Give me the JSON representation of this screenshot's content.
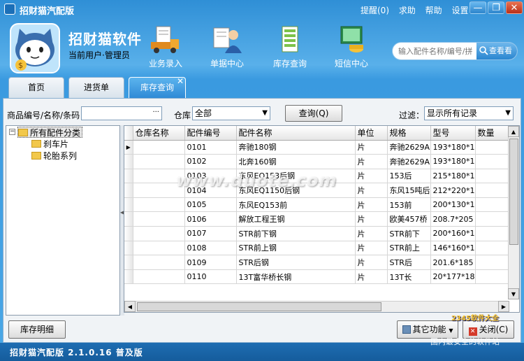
{
  "window": {
    "app_title": "招财猫汽配版",
    "min": "—",
    "restore": "❐",
    "close": "✕"
  },
  "top_links": [
    "提醒(0)",
    "求助",
    "帮助",
    "设置"
  ],
  "header": {
    "brand": "招财猫软件",
    "user": "当前用户·管理员"
  },
  "modules": [
    {
      "label": "业务录入",
      "icon": "truck-icon"
    },
    {
      "label": "单据中心",
      "icon": "person-icon"
    },
    {
      "label": "库存查询",
      "icon": "documents-icon"
    },
    {
      "label": "短信中心",
      "icon": "monitor-icon"
    }
  ],
  "search": {
    "placeholder": "输入配件名称/编号/拼",
    "button": "查看看"
  },
  "tabs": [
    {
      "label": "首页",
      "active": false
    },
    {
      "label": "进货单",
      "active": false
    },
    {
      "label": "库存查询",
      "active": true
    }
  ],
  "filter": {
    "product_label": "商品编号/名称/条码",
    "product_value": "",
    "ellipsis": "···",
    "warehouse_label": "仓库",
    "warehouse_value": "全部",
    "query_button": "查询(Q)",
    "filter_label": "过滤：",
    "filter_value": "显示所有记录"
  },
  "tree": {
    "root": "所有配件分类",
    "children": [
      "刹车片",
      "轮胎系列"
    ]
  },
  "table": {
    "columns": [
      "仓库名称",
      "配件编号",
      "配件名称",
      "单位",
      "规格",
      "型号",
      "数量"
    ],
    "rows": [
      [
        "",
        "0101",
        "奔驰180钢",
        "片",
        "奔驰2629A",
        "193*180*1",
        ""
      ],
      [
        "",
        "0102",
        "北奔160钢",
        "片",
        "奔驰2629A",
        "193*180*1",
        ""
      ],
      [
        "",
        "0103",
        "东风EQ153后钢",
        "片",
        "153后",
        "215*180*1",
        ""
      ],
      [
        "",
        "0104",
        "东风EQ1150后钢",
        "片",
        "东风15吨后",
        "212*220*1",
        ""
      ],
      [
        "",
        "0105",
        "东风EQ153前",
        "片",
        "153前",
        "200*130*1",
        ""
      ],
      [
        "",
        "0106",
        "解放工程王钢",
        "片",
        "欧美457桥",
        "208.7*205",
        ""
      ],
      [
        "",
        "0107",
        "STR前下钢",
        "片",
        "STR前下",
        "200*160*1",
        ""
      ],
      [
        "",
        "0108",
        "STR前上钢",
        "片",
        "STR前上",
        "146*160*1",
        ""
      ],
      [
        "",
        "0109",
        "STR后钢",
        "片",
        "STR后",
        "201.6*185",
        ""
      ],
      [
        "",
        "0110",
        "13T富华桥长钢",
        "片",
        "13T长",
        "20*177*18",
        ""
      ]
    ]
  },
  "buttons": {
    "inventory_detail": "库存明细",
    "other_functions": "其它功能",
    "close": "关闭(C)"
  },
  "footer": {
    "version": "招财猫汽配版  2.1.0.16 普及版"
  },
  "watermarks": {
    "center": "www.duote.com",
    "corner_top": "2345软件大全",
    "corner_bottom": "国内最安全的软件站"
  }
}
